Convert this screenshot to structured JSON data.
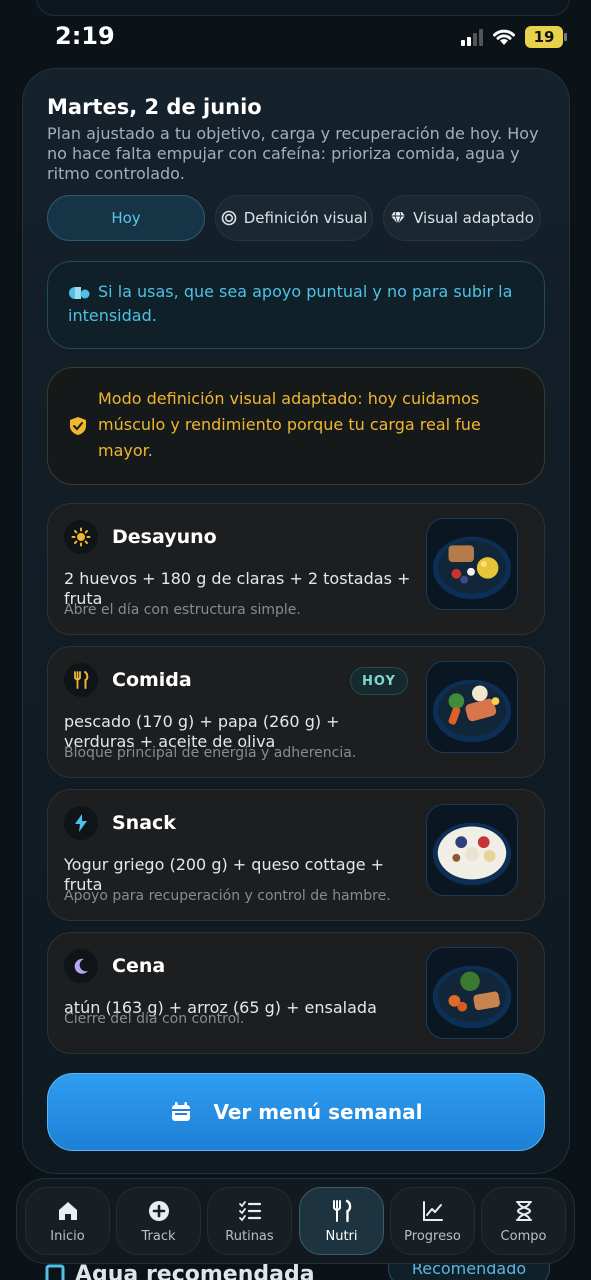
{
  "status": {
    "time": "2:19",
    "battery": "19"
  },
  "header": {
    "date": "Martes, 2 de junio",
    "subtitle": "Plan ajustado a tu objetivo, carga y recuperación de hoy. Hoy no hace falta empujar con cafeína: prioriza comida, agua y ritmo controlado."
  },
  "tabs": [
    {
      "label": "Hoy",
      "icon": "none"
    },
    {
      "label": "Definición visual",
      "icon": "target-icon"
    },
    {
      "label": "Visual adaptado",
      "icon": "diamond-icon"
    }
  ],
  "info_banner": {
    "text": "Si la usas, que sea apoyo puntual y no para subir la intensidad.",
    "icon": "pill-icon"
  },
  "warn_banner": {
    "text": "Modo definición visual adaptado: hoy cuidamos músculo y rendimiento porque tu carga real fue mayor.",
    "icon": "shield-icon"
  },
  "meals": [
    {
      "title": "Desayuno",
      "desc": "2 huevos + 180 g de claras + 2 tostadas + fruta",
      "note": "Abre el día con estructura simple.",
      "icon": "sun-icon",
      "badge": ""
    },
    {
      "title": "Comida",
      "desc": "pescado (170 g) + papa (260 g) + verduras + aceite de oliva",
      "note": "Bloque principal de energía y adherencia.",
      "icon": "utensils-icon",
      "badge": "HOY"
    },
    {
      "title": "Snack",
      "desc": "Yogur griego (200 g) + queso cottage + fruta",
      "note": "Apoyo para recuperación y control de hambre.",
      "icon": "bolt-icon",
      "badge": ""
    },
    {
      "title": "Cena",
      "desc": "atún (163 g) + arroz (65 g) + ensalada",
      "note": "Cierre del día con control.",
      "icon": "moon-icon",
      "badge": ""
    }
  ],
  "weekly_button": {
    "label": "Ver menú semanal",
    "icon": "calendar-icon"
  },
  "peek": {
    "title": "Agua recomendada",
    "pill": "Recomendado"
  },
  "nav": [
    {
      "label": "Inicio",
      "icon": "home-icon"
    },
    {
      "label": "Track",
      "icon": "plus-circle-icon"
    },
    {
      "label": "Rutinas",
      "icon": "checklist-icon"
    },
    {
      "label": "Nutri",
      "icon": "utensils-icon"
    },
    {
      "label": "Progreso",
      "icon": "chart-icon"
    },
    {
      "label": "Compo",
      "icon": "dna-icon"
    }
  ],
  "colors": {
    "accent": "#2f9df0",
    "warning": "#f0b62e",
    "info": "#4fc0e6",
    "background": "#0b1218"
  }
}
